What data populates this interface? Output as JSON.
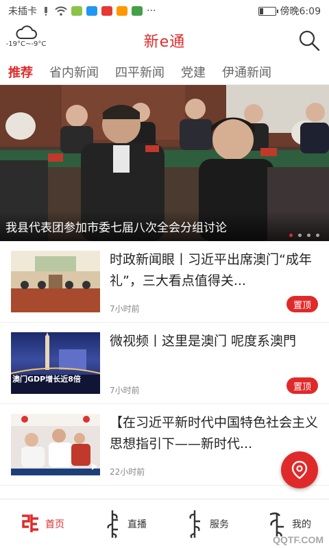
{
  "status_bar": {
    "carrier": "未插卡",
    "more": "···",
    "time": "傍晚6:09"
  },
  "header": {
    "weather_temp": "-19°C~-9°C",
    "title": "新e通"
  },
  "tabs": [
    {
      "label": "推荐",
      "active": true
    },
    {
      "label": "省内新闻",
      "active": false
    },
    {
      "label": "四平新闻",
      "active": false
    },
    {
      "label": "党建",
      "active": false
    },
    {
      "label": "伊通新闻",
      "active": false
    }
  ],
  "banner": {
    "caption": "我县代表团参加市委七届八次全会分组讨论",
    "slides": 4,
    "active_slide": 1
  },
  "news": [
    {
      "title": "时政新闻眼丨习近平出席澳门“成年礼”，三大看点值得关...",
      "time": "7小时前",
      "badge": "置顶"
    },
    {
      "title": "微视频丨这里是澳门 呢度系澳門",
      "time": "7小时前",
      "badge": "置顶",
      "thumb_text": "澳门GDP增长近8倍"
    },
    {
      "title": "【在习近平新时代中国特色社会主义思想指引下——新时代...",
      "time": "22小时前"
    }
  ],
  "bottom_nav": [
    {
      "label": "首页",
      "active": true
    },
    {
      "label": "直播",
      "active": false
    },
    {
      "label": "服务",
      "active": false
    },
    {
      "label": "我的",
      "active": false
    }
  ],
  "watermark": "QQTF.COM",
  "colors": {
    "accent": "#e02a2a"
  }
}
